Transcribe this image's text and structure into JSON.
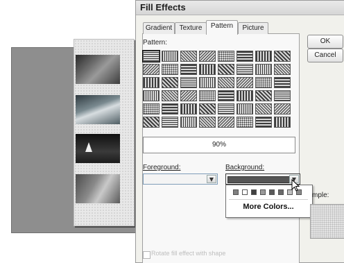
{
  "dialog": {
    "title": "Fill Effects",
    "tabs": [
      {
        "label": "Gradient"
      },
      {
        "label": "Texture"
      },
      {
        "label": "Pattern"
      },
      {
        "label": "Picture"
      }
    ],
    "active_tab": "Pattern"
  },
  "pattern_section": {
    "label": "Pattern:",
    "selected_pattern_name": "90%"
  },
  "foreground": {
    "label": "Foreground:",
    "value": ""
  },
  "background": {
    "label": "Background:",
    "selected_color": "#555555"
  },
  "color_popup": {
    "palette": [
      "#808080",
      "#ffffff",
      "#404040",
      "#9a9a9a",
      "#5a5a5a",
      "#6a6a6a",
      "#c0c0c0",
      "#8a8a8a"
    ],
    "more_colors_label": "More Colors..."
  },
  "buttons": {
    "ok": "OK",
    "cancel": "Cancel"
  },
  "sample": {
    "label": "mple:"
  },
  "rotate_option": {
    "label": "Rotate fill effect with shape",
    "checked": false
  }
}
